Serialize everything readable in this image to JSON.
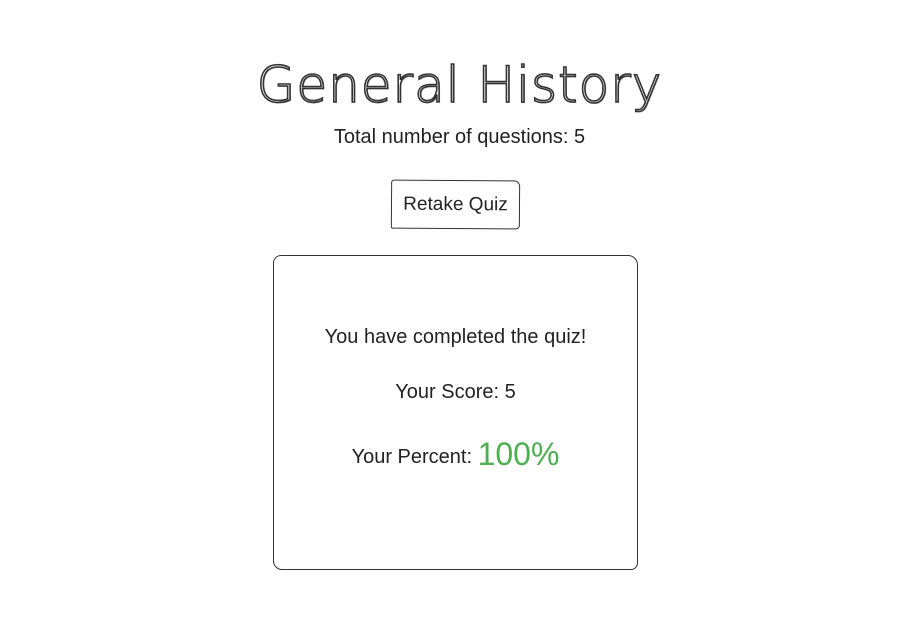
{
  "header": {
    "title": "General History"
  },
  "quiz_info": {
    "total_label": "Total number of questions:",
    "total_value": "5"
  },
  "actions": {
    "retake_label": "Retake Quiz"
  },
  "result": {
    "completed_message": "You have completed the quiz!",
    "score_label": "Your Score:",
    "score_value": "5",
    "percent_label": "Your Percent:",
    "percent_value": "100%",
    "percent_color": "#4caf50"
  }
}
